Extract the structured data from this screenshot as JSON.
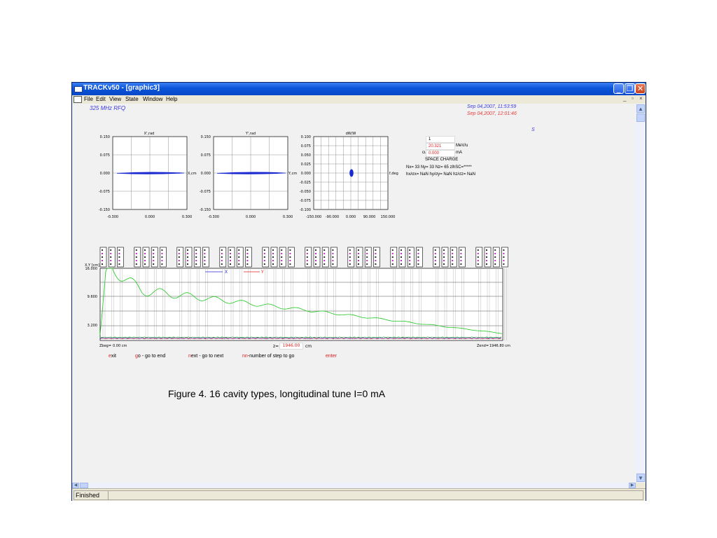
{
  "window": {
    "title": "TRACKv50 - [graphic3]",
    "buttons": {
      "minimize": "_",
      "restore": "❐",
      "close": "✕"
    }
  },
  "menu": {
    "items": [
      "File",
      "Edit",
      "View",
      "State",
      "Window",
      "Help"
    ],
    "mdi_controls": [
      "_",
      "▫",
      "×"
    ]
  },
  "header": {
    "rfq_label": "325 MHz RFQ",
    "date1": "Sep 04,2007, 11:53:59",
    "date2": "Sep 04,2007, 12:01:46",
    "s_marker": "S"
  },
  "plots": [
    {
      "title": "X',rad",
      "ylabels": [
        "0.150",
        "0.075",
        "0.000",
        "-0.075",
        "-0.150"
      ],
      "xlabels": [
        "-0.300",
        "0.000",
        "0.300"
      ],
      "axis_unit": "X,cm"
    },
    {
      "title": "Y',rad",
      "ylabels": [
        "0.150",
        "0.075",
        "0.000",
        "-0.075",
        "-0.150"
      ],
      "xlabels": [
        "-0.300",
        "0.000",
        "0.300"
      ],
      "axis_unit": "Y,cm"
    },
    {
      "title": "dW/W",
      "ylabels": [
        "0.100",
        "0.075",
        "0.050",
        "0.025",
        "0.000",
        "-0.025",
        "-0.050",
        "-0.075",
        "-0.100"
      ],
      "xlabels": [
        "-150.000",
        "-90.000",
        "0.000",
        "90.000",
        "150.000"
      ],
      "axis_unit": "f,deg"
    }
  ],
  "info_panel": {
    "q_label": "Q=",
    "q_value": "1",
    "w_label": "W=",
    "w_value": "20.321",
    "w_unit": "MeV/u",
    "current_label": "current=",
    "current_value": "0.000",
    "current_unit": "mA",
    "space_charge": "SPACE CHARGE",
    "grid_line": "Nx= 33   Ny= 33   Nz= 65   zlhSC=*****",
    "ratio_line": "hx/σx=  NaN  hy/σy=  NaN  hz/σz=  NaN"
  },
  "longplot": {
    "yaxis_title": "X,Y [cm]",
    "yticks": [
      "16.000",
      "9.600",
      "3.200"
    ],
    "legend": {
      "x": "X",
      "y": "Y"
    },
    "zbeg_label": "Zbeg=",
    "zbeg_value": "0.00 cm",
    "z_label": "z=",
    "z_value": "1946.00",
    "z_unit": "cm",
    "zend_label": "Zend=",
    "zend_value": "1946.80 cm",
    "colors": {
      "x_env": "#22c822",
      "y_env": "#e02020",
      "x_line": "#2a2ad0"
    }
  },
  "commands": {
    "exit_key": "e",
    "exit_rest": "xit",
    "go_key": "g",
    "go_rest": "o - go to end",
    "next_key": "n",
    "next_rest": "ext - go to next",
    "nn_key": "nn",
    "nn_rest": "-number of step to go",
    "enter": "enter"
  },
  "caption": "Figure 4. 16 cavity types, longitudinal tune I=0 mA",
  "status": {
    "text": "Finished"
  }
}
